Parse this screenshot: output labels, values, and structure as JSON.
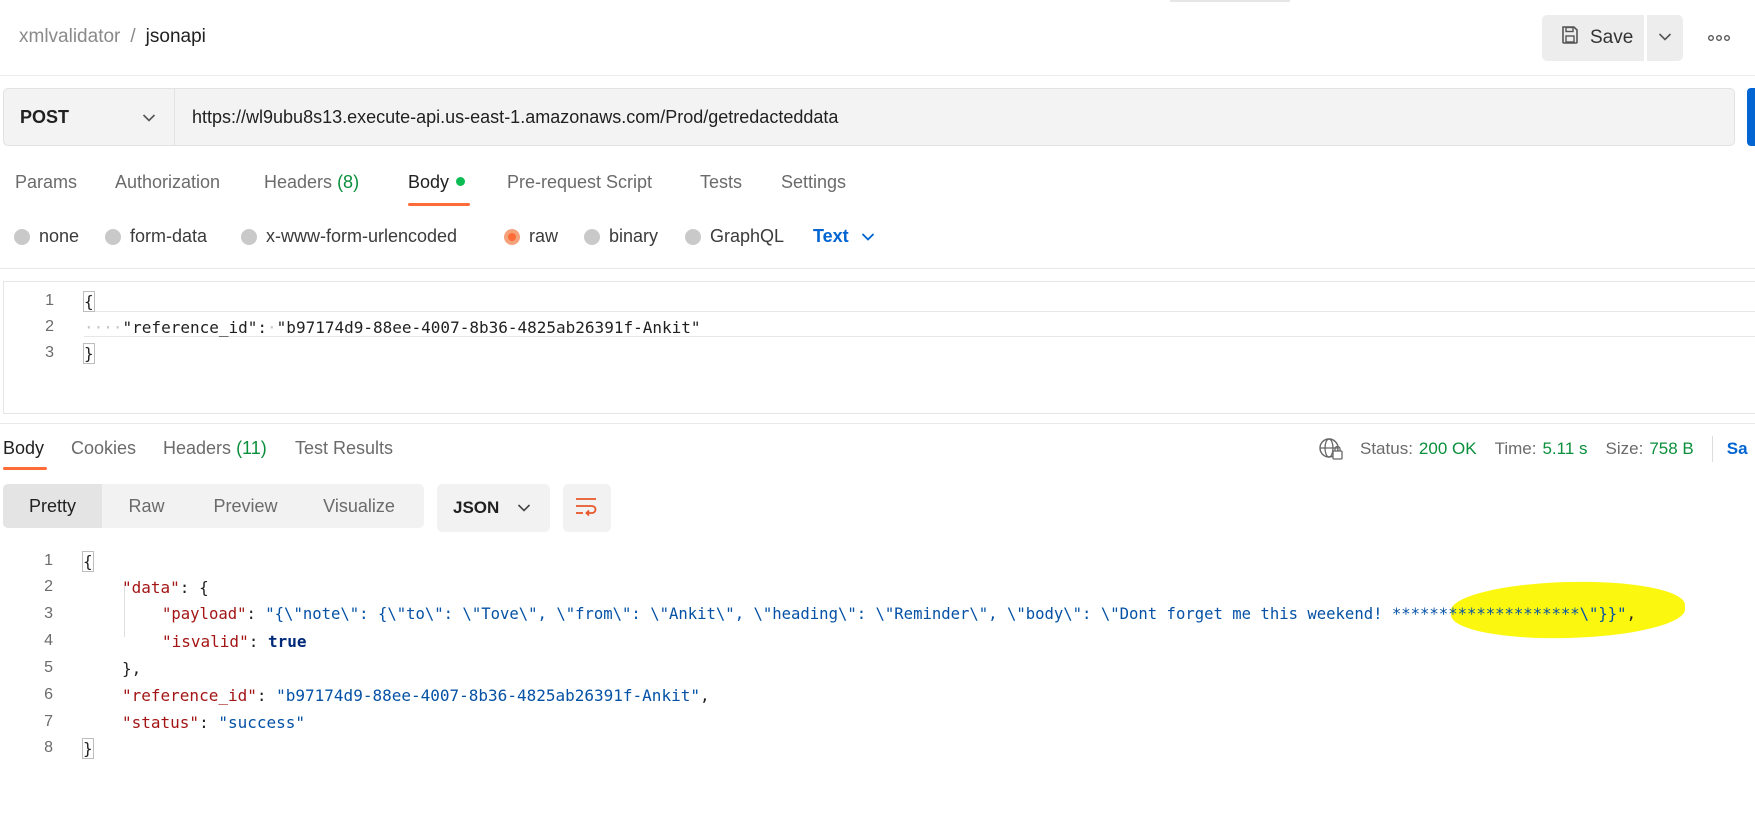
{
  "header": {
    "breadcrumb_parent": "xmlvalidator",
    "breadcrumb_separator": "/",
    "breadcrumb_current": "jsonapi",
    "save_label": "Save",
    "icons": {
      "save": "save-disk-icon",
      "dropdown": "chevron-down-icon",
      "more": "ellipsis-icon"
    }
  },
  "request": {
    "method": "POST",
    "url": "https://wl9ubu8s13.execute-api.us-east-1.amazonaws.com/Prod/getredacteddata"
  },
  "request_tabs": [
    {
      "label": "Params"
    },
    {
      "label": "Authorization"
    },
    {
      "label": "Headers",
      "count": "(8)"
    },
    {
      "label": "Body",
      "active": true
    },
    {
      "label": "Pre-request Script"
    },
    {
      "label": "Tests"
    },
    {
      "label": "Settings"
    }
  ],
  "body_types": [
    {
      "label": "none"
    },
    {
      "label": "form-data"
    },
    {
      "label": "x-www-form-urlencoded"
    },
    {
      "label": "raw",
      "selected": true
    },
    {
      "label": "binary"
    },
    {
      "label": "GraphQL"
    }
  ],
  "raw_format": "Text",
  "request_body": {
    "line_numbers": [
      "1",
      "2",
      "3"
    ],
    "open_brace": "{",
    "indent_dots": "····",
    "key": "\"reference_id\"",
    "colon": ":",
    "value": "\"b97174d9-88ee-4007-8b36-4825ab26391f-Ankit\"",
    "close_brace": "}"
  },
  "response_tabs": [
    {
      "label": "Body",
      "active": true
    },
    {
      "label": "Cookies"
    },
    {
      "label": "Headers",
      "count": "(11)"
    },
    {
      "label": "Test Results"
    }
  ],
  "response_status": {
    "status_label": "Status:",
    "status_value": "200 OK",
    "time_label": "Time:",
    "time_value": "5.11 s",
    "size_label": "Size:",
    "size_value": "758 B",
    "save_label": "Sa",
    "globe_icon": "globe-network-icon"
  },
  "view_modes": [
    "Pretty",
    "Raw",
    "Preview",
    "Visualize"
  ],
  "response_format": "JSON",
  "response_body": {
    "line_numbers": [
      "1",
      "2",
      "3",
      "4",
      "5",
      "6",
      "7",
      "8"
    ],
    "l1": "{",
    "l2_key": "\"data\"",
    "l2_rest": ": {",
    "l3_key": "\"payload\"",
    "l3_colon": ": ",
    "l3_value": "\"{\\\"note\\\": {\\\"to\\\": \\\"Tove\\\", \\\"from\\\": \\\"Ankit\\\", \\\"heading\\\": \\\"Reminder\\\", \\\"body\\\": \\\"Dont forget me this weekend! ********************\\\"}}\"",
    "l3_comma": ",",
    "l4_key": "\"isvalid\"",
    "l4_colon": ": ",
    "l4_value": "true",
    "l5": "},",
    "l6_key": "\"reference_id\"",
    "l6_colon": ": ",
    "l6_value": "\"b97174d9-88ee-4007-8b36-4825ab26391f-Ankit\"",
    "l6_comma": ",",
    "l7_key": "\"status\"",
    "l7_colon": ": ",
    "l7_value": "\"success\"",
    "l8": "}"
  },
  "colors": {
    "accent_orange": "#ff6c37",
    "primary_blue": "#0265d2",
    "status_green": "#0a8f3c",
    "highlight_yellow": "#fcf70e"
  }
}
